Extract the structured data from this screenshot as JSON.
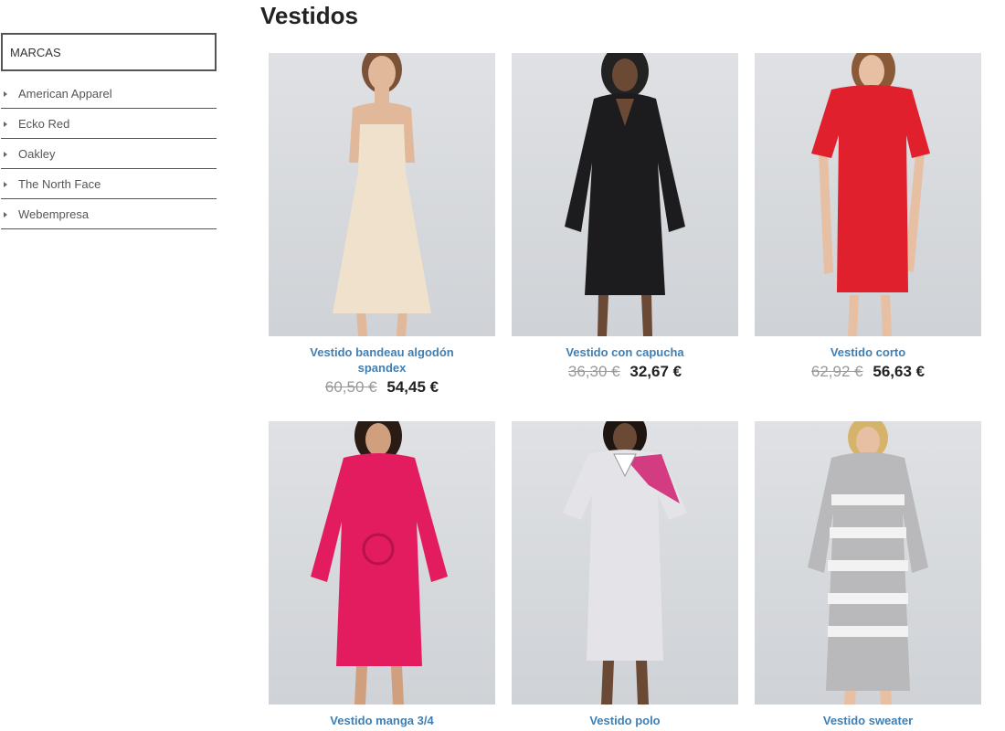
{
  "sidebar": {
    "title": "MARCAS",
    "brands": [
      {
        "label": "American Apparel"
      },
      {
        "label": "Ecko Red"
      },
      {
        "label": "Oakley"
      },
      {
        "label": "The North Face"
      },
      {
        "label": "Webempresa"
      }
    ]
  },
  "page": {
    "title": "Vestidos"
  },
  "products": [
    {
      "name": "Vestido bandeau algodón spandex",
      "old_price": "60,50 €",
      "price": "54,45 €",
      "dress_color": "#efe1cc"
    },
    {
      "name": "Vestido con capucha",
      "old_price": "36,30 €",
      "price": "32,67 €",
      "dress_color": "#1c1c1e"
    },
    {
      "name": "Vestido corto",
      "old_price": "62,92 €",
      "price": "56,63 €",
      "dress_color": "#e0202c"
    },
    {
      "name": "Vestido manga 3/4",
      "dress_color": "#e31c5f"
    },
    {
      "name": "Vestido polo",
      "dress_color": "#e4e4e8"
    },
    {
      "name": "Vestido sweater",
      "dress_color": "#b9b9bb"
    }
  ]
}
